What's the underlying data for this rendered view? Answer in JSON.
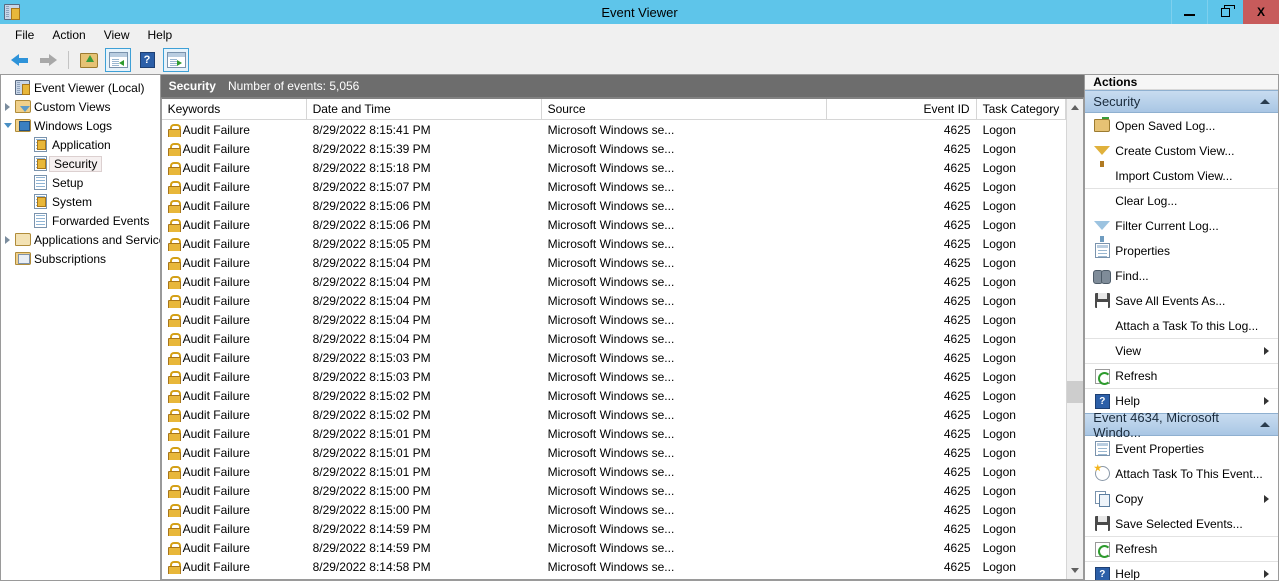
{
  "window": {
    "title": "Event Viewer",
    "icon": "event-viewer-icon",
    "minimize_label": "Minimize",
    "maximize_label": "Maximize",
    "close_label": "X",
    "titlebar_color": "#5ec5ea",
    "close_color": "#c75b5b"
  },
  "menu": {
    "items": [
      "File",
      "Action",
      "View",
      "Help"
    ]
  },
  "toolbar": {
    "buttons": [
      {
        "name": "back-arrow-icon",
        "label": "Back"
      },
      {
        "name": "forward-arrow-icon",
        "label": "Forward"
      },
      {
        "name": "up-one-level-icon",
        "label": "Up One Level"
      },
      {
        "name": "show-hide-console-tree-icon",
        "label": "Show/Hide Console Tree"
      },
      {
        "name": "help-icon",
        "label": "Help",
        "glyph": "?"
      },
      {
        "name": "show-hide-action-pane-icon",
        "label": "Show/Hide Action Pane"
      }
    ]
  },
  "tree": {
    "root": {
      "label": "Event Viewer (Local)",
      "icon": "event-viewer-icon"
    },
    "items": [
      {
        "label": "Custom Views",
        "icon": "folder-filter-icon",
        "indent": 1,
        "twisty": "collapsed",
        "selected": false
      },
      {
        "label": "Windows Logs",
        "icon": "folder-monitor-icon",
        "indent": 1,
        "twisty": "expanded",
        "selected": false
      },
      {
        "label": "Application",
        "icon": "log-warning-icon",
        "indent": 2,
        "twisty": "none",
        "selected": false
      },
      {
        "label": "Security",
        "icon": "log-warning-icon",
        "indent": 2,
        "twisty": "none",
        "selected": true
      },
      {
        "label": "Setup",
        "icon": "log-icon",
        "indent": 2,
        "twisty": "none",
        "selected": false
      },
      {
        "label": "System",
        "icon": "log-warning-icon",
        "indent": 2,
        "twisty": "none",
        "selected": false
      },
      {
        "label": "Forwarded Events",
        "icon": "log-icon",
        "indent": 2,
        "twisty": "none",
        "selected": false
      },
      {
        "label": "Applications and Services Lo",
        "icon": "folder-plain-icon",
        "indent": 1,
        "twisty": "collapsed",
        "selected": false
      },
      {
        "label": "Subscriptions",
        "icon": "subscriptions-icon",
        "indent": 1,
        "twisty": "none",
        "selected": false
      }
    ]
  },
  "log": {
    "name": "Security",
    "event_count_label": "Number of events: 5,056"
  },
  "list": {
    "columns": [
      "Keywords",
      "Date and Time",
      "Source",
      "Event ID",
      "Task Category"
    ],
    "rows": [
      {
        "keywords": "Audit Failure",
        "datetime": "8/29/2022 8:15:41 PM",
        "source": "Microsoft Windows se...",
        "event_id": "4625",
        "task": "Logon"
      },
      {
        "keywords": "Audit Failure",
        "datetime": "8/29/2022 8:15:39 PM",
        "source": "Microsoft Windows se...",
        "event_id": "4625",
        "task": "Logon"
      },
      {
        "keywords": "Audit Failure",
        "datetime": "8/29/2022 8:15:18 PM",
        "source": "Microsoft Windows se...",
        "event_id": "4625",
        "task": "Logon"
      },
      {
        "keywords": "Audit Failure",
        "datetime": "8/29/2022 8:15:07 PM",
        "source": "Microsoft Windows se...",
        "event_id": "4625",
        "task": "Logon"
      },
      {
        "keywords": "Audit Failure",
        "datetime": "8/29/2022 8:15:06 PM",
        "source": "Microsoft Windows se...",
        "event_id": "4625",
        "task": "Logon"
      },
      {
        "keywords": "Audit Failure",
        "datetime": "8/29/2022 8:15:06 PM",
        "source": "Microsoft Windows se...",
        "event_id": "4625",
        "task": "Logon"
      },
      {
        "keywords": "Audit Failure",
        "datetime": "8/29/2022 8:15:05 PM",
        "source": "Microsoft Windows se...",
        "event_id": "4625",
        "task": "Logon"
      },
      {
        "keywords": "Audit Failure",
        "datetime": "8/29/2022 8:15:04 PM",
        "source": "Microsoft Windows se...",
        "event_id": "4625",
        "task": "Logon"
      },
      {
        "keywords": "Audit Failure",
        "datetime": "8/29/2022 8:15:04 PM",
        "source": "Microsoft Windows se...",
        "event_id": "4625",
        "task": "Logon"
      },
      {
        "keywords": "Audit Failure",
        "datetime": "8/29/2022 8:15:04 PM",
        "source": "Microsoft Windows se...",
        "event_id": "4625",
        "task": "Logon"
      },
      {
        "keywords": "Audit Failure",
        "datetime": "8/29/2022 8:15:04 PM",
        "source": "Microsoft Windows se...",
        "event_id": "4625",
        "task": "Logon"
      },
      {
        "keywords": "Audit Failure",
        "datetime": "8/29/2022 8:15:04 PM",
        "source": "Microsoft Windows se...",
        "event_id": "4625",
        "task": "Logon"
      },
      {
        "keywords": "Audit Failure",
        "datetime": "8/29/2022 8:15:03 PM",
        "source": "Microsoft Windows se...",
        "event_id": "4625",
        "task": "Logon"
      },
      {
        "keywords": "Audit Failure",
        "datetime": "8/29/2022 8:15:03 PM",
        "source": "Microsoft Windows se...",
        "event_id": "4625",
        "task": "Logon"
      },
      {
        "keywords": "Audit Failure",
        "datetime": "8/29/2022 8:15:02 PM",
        "source": "Microsoft Windows se...",
        "event_id": "4625",
        "task": "Logon"
      },
      {
        "keywords": "Audit Failure",
        "datetime": "8/29/2022 8:15:02 PM",
        "source": "Microsoft Windows se...",
        "event_id": "4625",
        "task": "Logon"
      },
      {
        "keywords": "Audit Failure",
        "datetime": "8/29/2022 8:15:01 PM",
        "source": "Microsoft Windows se...",
        "event_id": "4625",
        "task": "Logon"
      },
      {
        "keywords": "Audit Failure",
        "datetime": "8/29/2022 8:15:01 PM",
        "source": "Microsoft Windows se...",
        "event_id": "4625",
        "task": "Logon"
      },
      {
        "keywords": "Audit Failure",
        "datetime": "8/29/2022 8:15:01 PM",
        "source": "Microsoft Windows se...",
        "event_id": "4625",
        "task": "Logon"
      },
      {
        "keywords": "Audit Failure",
        "datetime": "8/29/2022 8:15:00 PM",
        "source": "Microsoft Windows se...",
        "event_id": "4625",
        "task": "Logon"
      },
      {
        "keywords": "Audit Failure",
        "datetime": "8/29/2022 8:15:00 PM",
        "source": "Microsoft Windows se...",
        "event_id": "4625",
        "task": "Logon"
      },
      {
        "keywords": "Audit Failure",
        "datetime": "8/29/2022 8:14:59 PM",
        "source": "Microsoft Windows se...",
        "event_id": "4625",
        "task": "Logon"
      },
      {
        "keywords": "Audit Failure",
        "datetime": "8/29/2022 8:14:59 PM",
        "source": "Microsoft Windows se...",
        "event_id": "4625",
        "task": "Logon"
      },
      {
        "keywords": "Audit Failure",
        "datetime": "8/29/2022 8:14:58 PM",
        "source": "Microsoft Windows se...",
        "event_id": "4625",
        "task": "Logon"
      }
    ]
  },
  "actions": {
    "title": "Actions",
    "sections": [
      {
        "header": "Security",
        "items": [
          {
            "label": "Open Saved Log...",
            "icon": "open-saved-log-icon",
            "submenu": false,
            "divider": false
          },
          {
            "label": "Create Custom View...",
            "icon": "create-custom-view-icon",
            "submenu": false,
            "divider": false
          },
          {
            "label": "Import Custom View...",
            "icon": "none",
            "submenu": false,
            "divider": false
          },
          {
            "label": "Clear Log...",
            "icon": "none",
            "submenu": false,
            "divider": true
          },
          {
            "label": "Filter Current Log...",
            "icon": "filter-current-log-icon",
            "submenu": false,
            "divider": false
          },
          {
            "label": "Properties",
            "icon": "properties-icon",
            "submenu": false,
            "divider": false
          },
          {
            "label": "Find...",
            "icon": "find-icon",
            "submenu": false,
            "divider": false
          },
          {
            "label": "Save All Events As...",
            "icon": "save-icon",
            "submenu": false,
            "divider": false
          },
          {
            "label": "Attach a Task To this Log...",
            "icon": "none",
            "submenu": false,
            "divider": false
          },
          {
            "label": "View",
            "icon": "none",
            "submenu": true,
            "divider": true
          },
          {
            "label": "Refresh",
            "icon": "refresh-icon",
            "submenu": false,
            "divider": true
          },
          {
            "label": "Help",
            "icon": "help-icon",
            "submenu": true,
            "divider": true
          }
        ]
      },
      {
        "header": "Event 4634, Microsoft Windo...",
        "items": [
          {
            "label": "Event Properties",
            "icon": "properties-icon",
            "submenu": false,
            "divider": false
          },
          {
            "label": "Attach Task To This Event...",
            "icon": "attach-task-icon",
            "submenu": false,
            "divider": false
          },
          {
            "label": "Copy",
            "icon": "copy-icon",
            "submenu": true,
            "divider": false
          },
          {
            "label": "Save Selected Events...",
            "icon": "save-icon",
            "submenu": false,
            "divider": false
          },
          {
            "label": "Refresh",
            "icon": "refresh-icon",
            "submenu": false,
            "divider": true
          },
          {
            "label": "Help",
            "icon": "help-icon",
            "submenu": true,
            "divider": true
          }
        ]
      }
    ]
  }
}
